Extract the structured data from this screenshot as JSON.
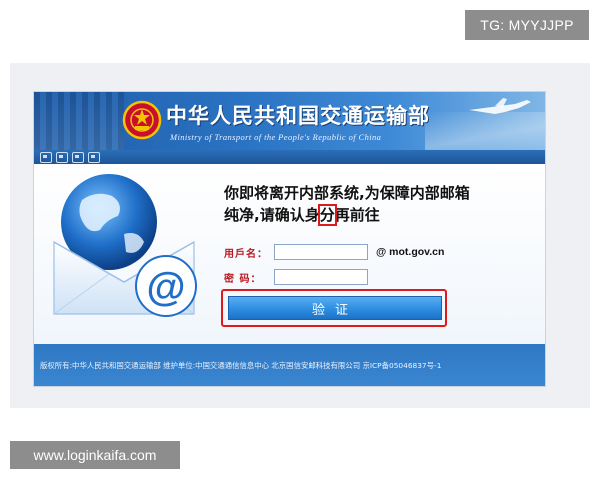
{
  "tag": "TG: MYYJJPP",
  "banner": {
    "title": "中华人民共和国交通运输部",
    "subtitle": "Ministry of Transport of the People's Republic of China"
  },
  "notice": {
    "line1": "你即将离开内部系统,为保障内部邮箱",
    "line2_before": "纯净,请确认身",
    "line2_highlight": "分",
    "line2_after": "再前往"
  },
  "form": {
    "username_label": "用戶名：",
    "username_value": "",
    "domain": "@  mot.gov.cn",
    "password_label": "密  码：",
    "password_value": ""
  },
  "verify_button": {
    "label": "验证"
  },
  "footer": {
    "text": "版权所有:中华人民共和国交通运输部 维护单位:中国交通通信信息中心 北京国信安邮科技有限公司 京ICP备05046837号-1"
  },
  "watermark": "www.loginkaifa.com",
  "icons": {
    "emblem": "national-emblem-icon",
    "globe": "globe-icon",
    "envelope": "envelope-icon",
    "at": "at-sign-icon",
    "plane": "airplane-icon"
  },
  "colors": {
    "banner_blue": "#2a72c2",
    "footer_blue": "#3b86d0",
    "highlight_red": "#e0191c",
    "button_blue": "#2f8de0",
    "label_red": "#b81c22"
  }
}
